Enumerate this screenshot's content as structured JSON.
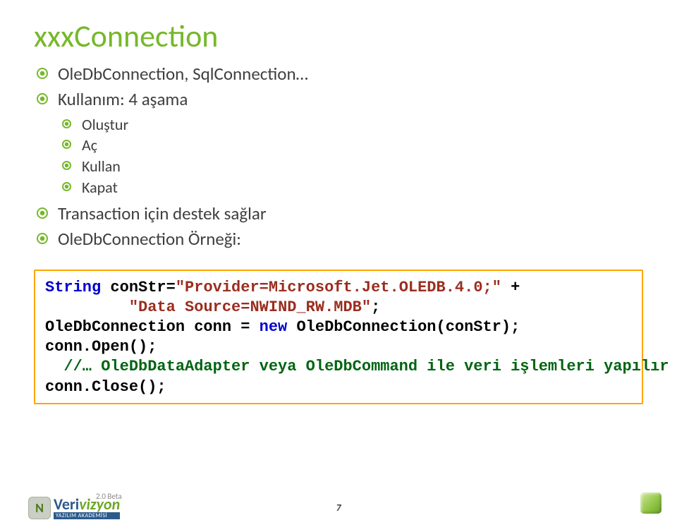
{
  "title": "xxxConnection",
  "bullets": {
    "b0": "OleDbConnection, SqlConnection…",
    "b1": "Kullanım: 4 aşama",
    "b1_children": {
      "c0": "Oluştur",
      "c1": "Aç",
      "c2": "Kullan",
      "c3": "Kapat"
    },
    "b2": "Transaction için destek sağlar",
    "b3": "OleDbConnection Örneği:"
  },
  "code": {
    "l1a": "String",
    "l1b": " conStr=",
    "l1c": "\"Provider=Microsoft.Jet.OLEDB.4.0;\"",
    "l1d": " +",
    "l2a": "         ",
    "l2b": "\"Data Source=NWIND_RW.MDB\"",
    "l2c": ";",
    "l3a": "OleDbConnection conn = ",
    "l3b": "new",
    "l3c": " OleDbConnection(conStr);",
    "l4": "conn.Open();",
    "l5a": "  //… OleDbDataAdapter veya OleDbCommand ile veri işlemleri yapılır",
    "l6": "conn.Close();"
  },
  "page_number": "7",
  "logo": {
    "badge_beta": "2.0 Beta",
    "letter": "N",
    "name_a": "Veri",
    "name_b": "vizyon",
    "sub": "YAZILIM AKADEMİSİ"
  }
}
